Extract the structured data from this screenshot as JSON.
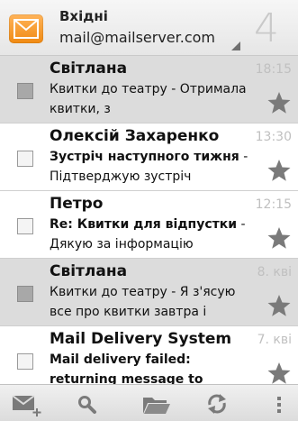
{
  "header": {
    "folder": "Вхідні",
    "account": "mail@mailserver.com",
    "count": "4"
  },
  "messages": [
    {
      "sender": "Світлана",
      "subject": "Квитки до театру",
      "snippet": " - Отримала квитки, з",
      "date": "18:15",
      "read": true
    },
    {
      "sender": "Олексій Захаренко",
      "subject": "Зустріч наступного тижня",
      "snippet": " - Підтверджую зустріч",
      "date": "13:30",
      "read": false
    },
    {
      "sender": "Петро",
      "subject": "Re: Квитки для відпустки",
      "snippet": " - Дякую за інформацію",
      "date": "12:15",
      "read": false
    },
    {
      "sender": "Світлана",
      "subject": "Квитки до театру",
      "snippet": " - Я з'ясую все про квитки завтра і",
      "date": "8. кві",
      "read": true
    },
    {
      "sender": "Mail Delivery System",
      "subject": "Mail delivery failed: returning message to",
      "snippet": "",
      "date": "7. кві",
      "read": false
    }
  ],
  "icons": {
    "app": "mail-envelope-icon",
    "star": "star-icon",
    "compose": "compose-icon",
    "search": "search-icon",
    "folders": "folder-icon",
    "refresh": "refresh-icon",
    "overflow": "overflow-menu-icon"
  },
  "colors": {
    "accent": "#f39c1f",
    "read_row": "#dcdcdc",
    "icon_gray": "#7a7a7a"
  }
}
